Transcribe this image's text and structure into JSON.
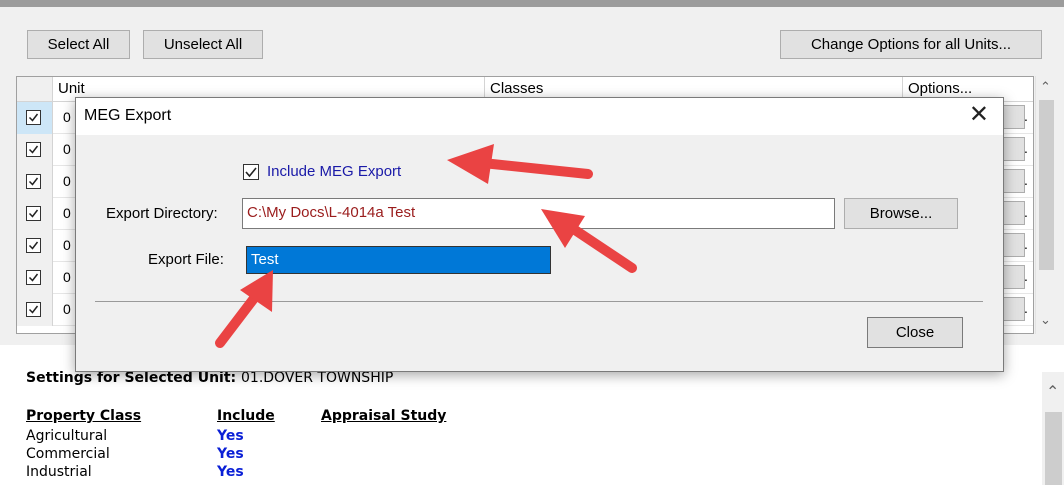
{
  "toolbar": {
    "select_all": "Select All",
    "unselect_all": "Unselect All",
    "change_options": "Change Options for all Units..."
  },
  "grid": {
    "headers": [
      "Unit",
      "Classes",
      "Options..."
    ],
    "rows": [
      {
        "checked": true,
        "unit": "0"
      },
      {
        "checked": true,
        "unit": "0"
      },
      {
        "checked": true,
        "unit": "0"
      },
      {
        "checked": true,
        "unit": "0"
      },
      {
        "checked": true,
        "unit": "0"
      },
      {
        "checked": true,
        "unit": "0"
      },
      {
        "checked": true,
        "unit": "0"
      }
    ],
    "cell_suffix": "."
  },
  "dialog": {
    "title": "MEG Export",
    "include_label": "Include MEG Export",
    "include_checked": true,
    "export_dir_label": "Export Directory:",
    "export_dir_value": "C:\\My Docs\\L-4014a Test",
    "browse_label": "Browse...",
    "export_file_label": "Export File:",
    "export_file_value": "Test",
    "close_label": "Close"
  },
  "settings": {
    "title_prefix": "Settings for Selected Unit:",
    "title_value": "01.DOVER TOWNSHIP",
    "columns": [
      "Property Class",
      "Include",
      "Appraisal Study"
    ],
    "rows": [
      {
        "class": "Agricultural",
        "include": "Yes"
      },
      {
        "class": "Commercial",
        "include": "Yes"
      },
      {
        "class": "Industrial",
        "include": "Yes"
      }
    ]
  },
  "colors": {
    "annotation_arrow": "#ea4343",
    "selection": "#0078d7",
    "include_yes": "#0a1fd6"
  }
}
